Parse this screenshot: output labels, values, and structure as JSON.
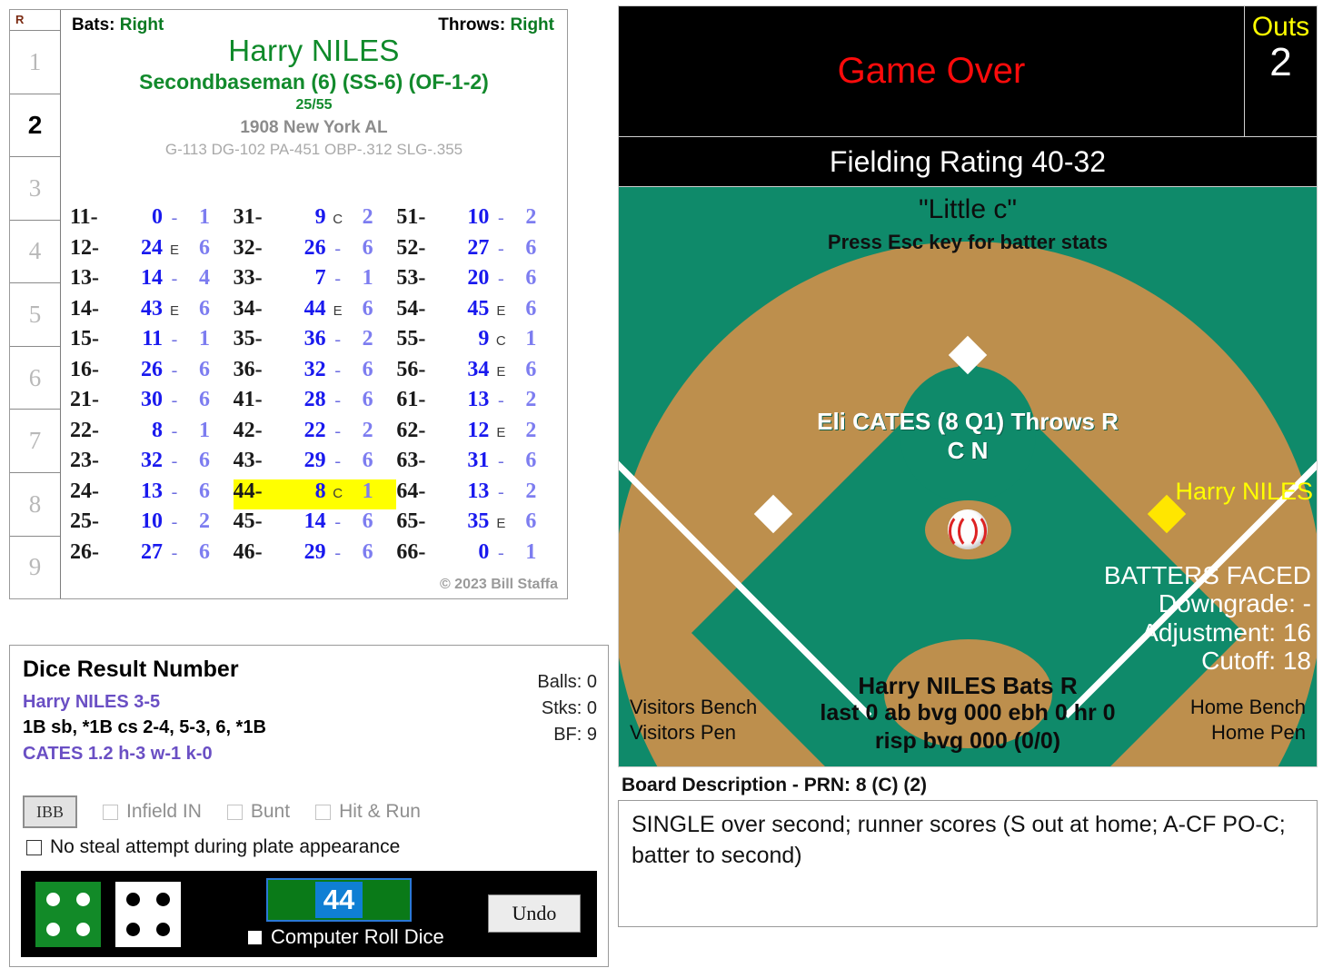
{
  "inning_rail": {
    "header": "R",
    "innings": [
      "1",
      "2",
      "3",
      "4",
      "5",
      "6",
      "7",
      "8",
      "9"
    ],
    "active": "2"
  },
  "player_card": {
    "bats_label": "Bats:",
    "bats_value": "Right",
    "throws_label": "Throws:",
    "throws_value": "Right",
    "name": "Harry NILES",
    "position": "Secondbaseman (6) (SS-6) (OF-1-2)",
    "fraction": "25/55",
    "team": "1908 New York AL",
    "stats": "G-113 DG-102 PA-451 OBP-.312 SLG-.355",
    "copyright": "© 2023 Bill Staffa"
  },
  "dice_table": {
    "columns": [
      [
        {
          "key": "11-",
          "num": "0",
          "mid": "-",
          "end": "1"
        },
        {
          "key": "12-",
          "num": "24",
          "mid": "E",
          "end": "6"
        },
        {
          "key": "13-",
          "num": "14",
          "mid": "-",
          "end": "4"
        },
        {
          "key": "14-",
          "num": "43",
          "mid": "E",
          "end": "6"
        },
        {
          "key": "15-",
          "num": "11",
          "mid": "-",
          "end": "1"
        },
        {
          "key": "16-",
          "num": "26",
          "mid": "-",
          "end": "6"
        },
        {
          "key": "21-",
          "num": "30",
          "mid": "-",
          "end": "6"
        },
        {
          "key": "22-",
          "num": "8",
          "mid": "-",
          "end": "1"
        },
        {
          "key": "23-",
          "num": "32",
          "mid": "-",
          "end": "6"
        },
        {
          "key": "24-",
          "num": "13",
          "mid": "-",
          "end": "6"
        },
        {
          "key": "25-",
          "num": "10",
          "mid": "-",
          "end": "2"
        },
        {
          "key": "26-",
          "num": "27",
          "mid": "-",
          "end": "6"
        }
      ],
      [
        {
          "key": "31-",
          "num": "9",
          "mid": "C",
          "end": "2"
        },
        {
          "key": "32-",
          "num": "26",
          "mid": "-",
          "end": "6"
        },
        {
          "key": "33-",
          "num": "7",
          "mid": "-",
          "end": "1"
        },
        {
          "key": "34-",
          "num": "44",
          "mid": "E",
          "end": "6"
        },
        {
          "key": "35-",
          "num": "36",
          "mid": "-",
          "end": "2"
        },
        {
          "key": "36-",
          "num": "32",
          "mid": "-",
          "end": "6"
        },
        {
          "key": "41-",
          "num": "28",
          "mid": "-",
          "end": "6"
        },
        {
          "key": "42-",
          "num": "22",
          "mid": "-",
          "end": "2"
        },
        {
          "key": "43-",
          "num": "29",
          "mid": "-",
          "end": "6"
        },
        {
          "key": "44-",
          "num": "8",
          "mid": "C",
          "end": "1",
          "highlight": true
        },
        {
          "key": "45-",
          "num": "14",
          "mid": "-",
          "end": "6"
        },
        {
          "key": "46-",
          "num": "29",
          "mid": "-",
          "end": "6"
        }
      ],
      [
        {
          "key": "51-",
          "num": "10",
          "mid": "-",
          "end": "2"
        },
        {
          "key": "52-",
          "num": "27",
          "mid": "-",
          "end": "6"
        },
        {
          "key": "53-",
          "num": "20",
          "mid": "-",
          "end": "6"
        },
        {
          "key": "54-",
          "num": "45",
          "mid": "E",
          "end": "6"
        },
        {
          "key": "55-",
          "num": "9",
          "mid": "C",
          "end": "1"
        },
        {
          "key": "56-",
          "num": "34",
          "mid": "E",
          "end": "6"
        },
        {
          "key": "61-",
          "num": "13",
          "mid": "-",
          "end": "2"
        },
        {
          "key": "62-",
          "num": "12",
          "mid": "E",
          "end": "2"
        },
        {
          "key": "63-",
          "num": "31",
          "mid": "-",
          "end": "6"
        },
        {
          "key": "64-",
          "num": "13",
          "mid": "-",
          "end": "2"
        },
        {
          "key": "65-",
          "num": "35",
          "mid": "E",
          "end": "6"
        },
        {
          "key": "66-",
          "num": "0",
          "mid": "-",
          "end": "1"
        }
      ]
    ]
  },
  "dice_panel": {
    "title": "Dice Result Number",
    "batter_line": "Harry NILES  3-5",
    "result_line": "1B sb, *1B cs 2-4, 5-3, 6, *1B",
    "pitcher_line": "CATES  1.2  h-3  w-1  k-0",
    "balls": "Balls: 0",
    "strikes": "Stks: 0",
    "bf": "BF: 9",
    "ibb_label": "IBB",
    "infield_in_label": "Infield IN",
    "bunt_label": "Bunt",
    "hit_run_label": "Hit & Run",
    "no_steal_label": "No steal attempt during plate appearance",
    "roll_value": "44",
    "computer_roll_label": "Computer Roll Dice",
    "undo_label": "Undo",
    "die1_value": "4",
    "die2_value": "4"
  },
  "scoreboard": {
    "status": "Game Over",
    "outs_label": "Outs",
    "outs_value": "2",
    "fielding_rating": "Fielding Rating 40-32"
  },
  "field": {
    "little_c": "\"Little c\"",
    "esc_hint": "Press Esc key for batter stats",
    "pitcher_name": "Eli CATES (8 Q1) Throws R",
    "pitcher_sub": "C N",
    "runner_name": "Harry NILES",
    "batters_faced_title": "BATTERS FACED",
    "downgrade": "Downgrade: -",
    "adjustment": "Adjustment: 16",
    "cutoff": "Cutoff: 18",
    "batter_name": "Harry NILES Bats R",
    "batter_line1": "last 0 ab bvg 000 ebh 0 hr 0",
    "batter_line2": "risp bvg 000 (0/0)",
    "visitors_bench": "Visitors Bench",
    "visitors_pen": "Visitors Pen",
    "home_bench": "Home Bench",
    "home_pen": "Home Pen"
  },
  "board_description": {
    "label": "Board Description - PRN: 8 (C) (2)",
    "text": "SINGLE over second; runner scores (S out at home; A-CF PO-C; batter to second)"
  },
  "colors": {
    "field_green": "#0f8a6a",
    "dirt": "#bd8f4d",
    "highlight_yellow": "#ffff00",
    "status_red": "#ff0b0b",
    "name_green": "#0f8a2a"
  }
}
